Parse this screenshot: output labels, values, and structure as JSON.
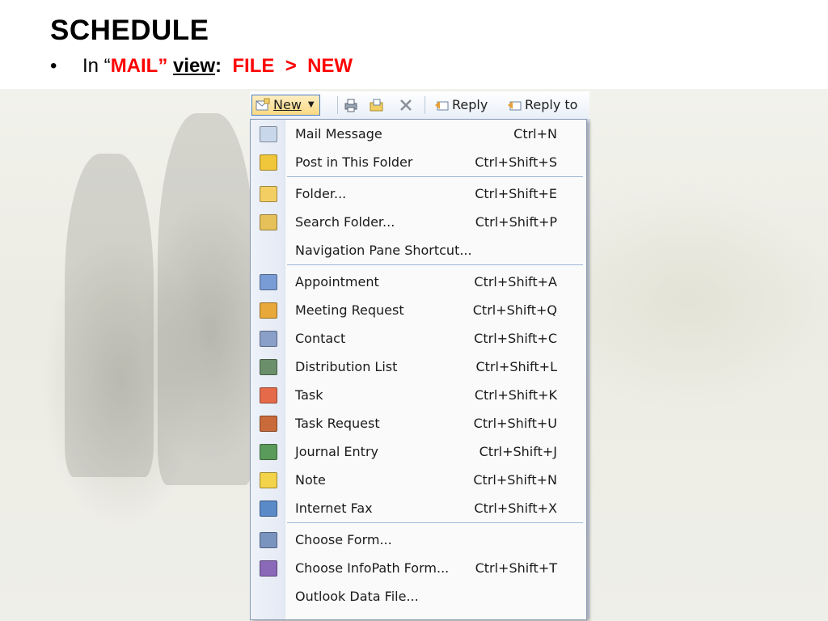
{
  "slide": {
    "title": "SCHEDULE",
    "bullet_prefix": "In “",
    "bullet_mail": "MAIL”",
    "bullet_view": "view",
    "bullet_colon": ":",
    "bullet_path": "FILE  >  NEW"
  },
  "toolbar": {
    "new_label": "New",
    "reply_label": "Reply",
    "reply_to_label": "Reply to"
  },
  "menu": {
    "items": [
      {
        "label": "Mail Message",
        "shortcut": "Ctrl+N",
        "icon": "mail-message-icon",
        "color": "#c9d7ea"
      },
      {
        "label": "Post in This Folder",
        "shortcut": "Ctrl+Shift+S",
        "icon": "post-icon",
        "color": "#f0c63a"
      },
      {
        "label": "Folder...",
        "shortcut": "Ctrl+Shift+E",
        "icon": "folder-icon",
        "color": "#f3cf63"
      },
      {
        "label": "Search Folder...",
        "shortcut": "Ctrl+Shift+P",
        "icon": "search-folder-icon",
        "color": "#e6c15a"
      },
      {
        "label": "Navigation Pane Shortcut...",
        "shortcut": "",
        "icon": "",
        "color": ""
      },
      {
        "label": "Appointment",
        "shortcut": "Ctrl+Shift+A",
        "icon": "calendar-icon",
        "color": "#7a9cd6"
      },
      {
        "label": "Meeting Request",
        "shortcut": "Ctrl+Shift+Q",
        "icon": "meeting-icon",
        "color": "#e8a83a"
      },
      {
        "label": "Contact",
        "shortcut": "Ctrl+Shift+C",
        "icon": "contact-card-icon",
        "color": "#8aa0c8"
      },
      {
        "label": "Distribution List",
        "shortcut": "Ctrl+Shift+L",
        "icon": "distribution-list-icon",
        "color": "#6a8f6a"
      },
      {
        "label": "Task",
        "shortcut": "Ctrl+Shift+K",
        "icon": "task-icon",
        "color": "#e46a4a"
      },
      {
        "label": "Task Request",
        "shortcut": "Ctrl+Shift+U",
        "icon": "task-request-icon",
        "color": "#c96a3a"
      },
      {
        "label": "Journal Entry",
        "shortcut": "Ctrl+Shift+J",
        "icon": "journal-icon",
        "color": "#5a9a5a"
      },
      {
        "label": "Note",
        "shortcut": "Ctrl+Shift+N",
        "icon": "note-icon",
        "color": "#f2d34a"
      },
      {
        "label": "Internet Fax",
        "shortcut": "Ctrl+Shift+X",
        "icon": "fax-globe-icon",
        "color": "#5a8ac8"
      },
      {
        "label": "Choose Form...",
        "shortcut": "",
        "icon": "form-icon",
        "color": "#7a94c0"
      },
      {
        "label": "Choose InfoPath Form...",
        "shortcut": "Ctrl+Shift+T",
        "icon": "infopath-icon",
        "color": "#8a6ab8"
      },
      {
        "label": "Outlook Data File...",
        "shortcut": "",
        "icon": "",
        "color": ""
      }
    ]
  }
}
